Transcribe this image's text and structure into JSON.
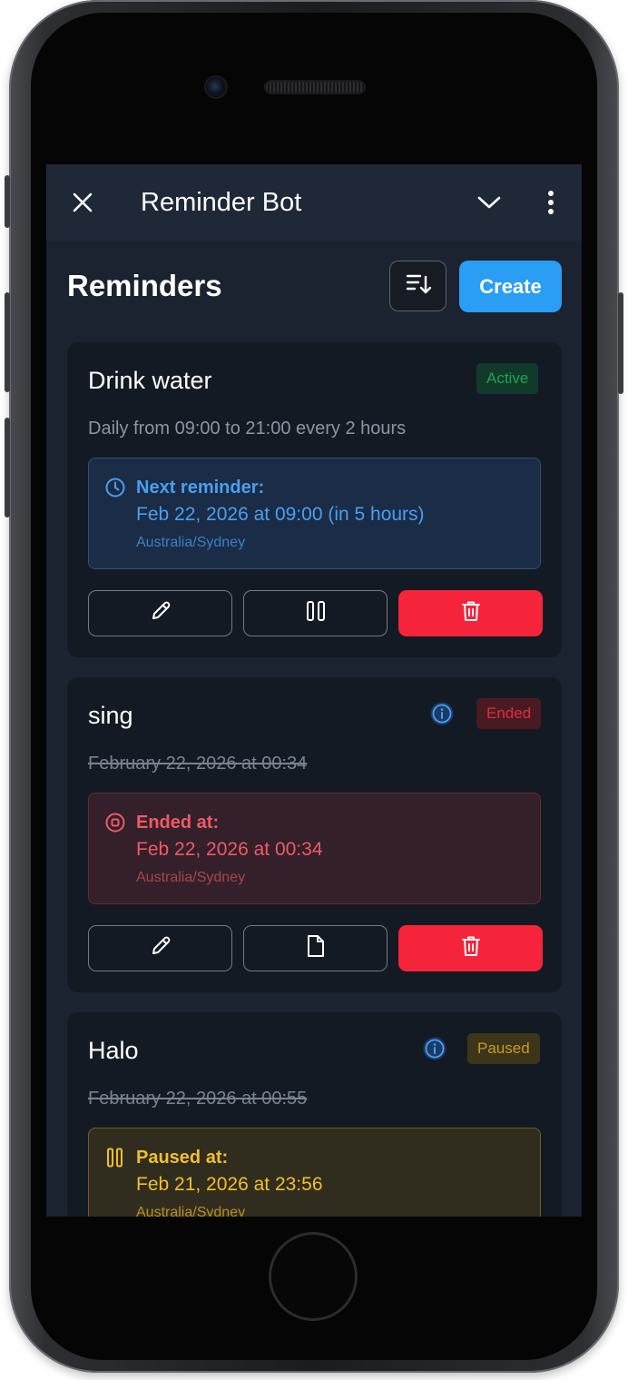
{
  "app": {
    "title": "Reminder Bot"
  },
  "topbar": {
    "close_icon": "close-icon",
    "collapse_icon": "chevron-down-icon",
    "menu_icon": "more-vertical-icon"
  },
  "header": {
    "page_title": "Reminders",
    "sort_icon": "sort-icon",
    "create_label": "Create"
  },
  "reminders": [
    {
      "name": "Drink water",
      "status": "Active",
      "schedule": "Daily from 09:00 to 21:00 every 2 hours",
      "detail_label": "Next reminder:",
      "detail_time": "Feb 22, 2026 at 09:00 (in 5 hours)",
      "timezone": "Australia/Sydney",
      "actions": [
        "edit-icon",
        "pause-icon",
        "delete-icon"
      ]
    },
    {
      "name": "sing",
      "status": "Ended",
      "schedule": "February 22, 2026 at 00:34",
      "detail_label": "Ended at:",
      "detail_time": "Feb 22, 2026 at 00:34",
      "timezone": "Australia/Sydney",
      "actions": [
        "edit-icon",
        "document-icon",
        "delete-icon"
      ]
    },
    {
      "name": "Halo",
      "status": "Paused",
      "schedule": "February 22, 2026 at 00:55",
      "detail_label": "Paused at:",
      "detail_time": "Feb 21, 2026 at 23:56",
      "timezone": "Australia/Sydney"
    }
  ],
  "colors": {
    "accent": "#2a9df4",
    "danger": "#f5243a",
    "active": "#1ea35a",
    "ended": "#d9303f",
    "paused": "#c99a1e"
  }
}
